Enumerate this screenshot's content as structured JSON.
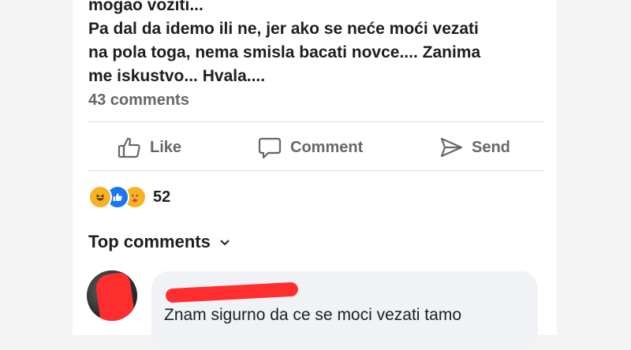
{
  "post": {
    "lines": [
      "mogao voziti...",
      "Pa dal da idemo ili ne, jer ako se neće moći vezati",
      "na pola toga, nema smisla bacati novce.... Zanima",
      "me iskustvo... Hvala...."
    ],
    "comments_count": "43 comments"
  },
  "actions": {
    "like": "Like",
    "comment": "Comment",
    "send": "Send"
  },
  "reactions": {
    "types": [
      "haha-icon",
      "like-icon",
      "care-icon"
    ],
    "count": "52"
  },
  "top_comments": {
    "label": "Top comments"
  },
  "comment": {
    "text": "Znam sigurno da ce se moci vezati tamo"
  },
  "colors": {
    "redaction": "#ff2e2e",
    "like_blue": "#1877f2",
    "reaction_yellow": "#f7b125"
  }
}
